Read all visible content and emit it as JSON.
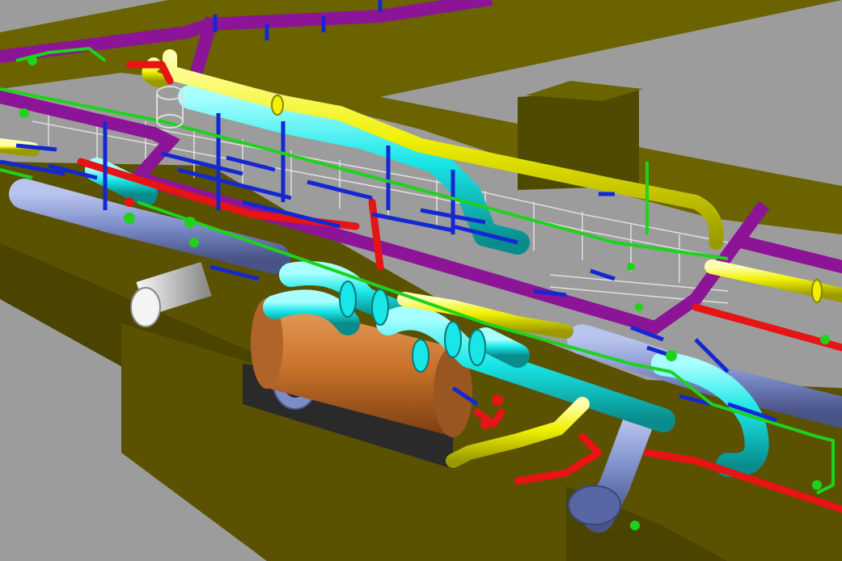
{
  "viewport": {
    "kind": "3D plant piping model (isometric view)",
    "background_color": "#9c9c9c"
  },
  "legend_colors": {
    "floor_slab": "#5a5200",
    "equipment_body": "#c8722a",
    "pipe_cyan": "#19e6e6",
    "pipe_yellow": "#f0f000",
    "pipe_magenta": "#8c1496",
    "pipe_red": "#e61414",
    "pipe_blue": "#1428d2",
    "pipe_green": "#1ed21e",
    "duct_slate": "#7c8cc8",
    "duct_grey": "#c8c8c8",
    "handrail": "#e0e0e0",
    "block": "#2a2a2a"
  }
}
